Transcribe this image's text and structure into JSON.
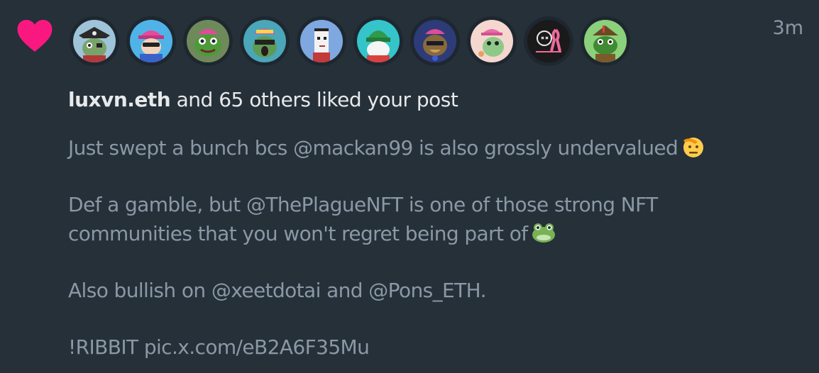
{
  "notification": {
    "timestamp": "3m",
    "summary": {
      "user": "luxvn.eth",
      "rest": " and 65 others liked your post"
    },
    "avatars": [
      {
        "name": "pirate-frog-avatar",
        "bg": "#9fc3d8"
      },
      {
        "name": "capped-character-avatar",
        "bg": "#4fb3e8"
      },
      {
        "name": "green-frog-avatar",
        "bg": "#6e8a5a"
      },
      {
        "name": "scream-frog-avatar",
        "bg": "#4aa6b8"
      },
      {
        "name": "pixel-punk-avatar",
        "bg": "#7fa8e0"
      },
      {
        "name": "green-beanie-avatar",
        "bg": "#35c4c9"
      },
      {
        "name": "dark-blue-avatar",
        "bg": "#2d3c78"
      },
      {
        "name": "pink-cap-frog-avatar",
        "bg": "#f4d7cf"
      },
      {
        "name": "skull-ribbon-avatar",
        "bg": "#1a1a1a"
      },
      {
        "name": "hunter-frog-avatar",
        "bg": "#8bd07a"
      }
    ],
    "post": {
      "line1_text": "Just swept a bunch bcs ",
      "line1_mention": "@mackan99",
      "line1_rest": " is also grossly undervalued",
      "line2_text": "Def a gamble, but ",
      "line2_mention": "@ThePlagueNFT",
      "line2_rest": " is one of those strong NFT",
      "line3_text": "communities that you won't regret being part of",
      "line4_text": "Also bullish on ",
      "line4_mention1": "@xeetdotai",
      "line4_mid": " and ",
      "line4_mention2": "@Pons_ETH",
      "line4_end": ".",
      "line5_text": "!RIBBIT ",
      "line5_link": "pic.x.com/eB2A6F35Mu"
    },
    "colors": {
      "background": "#253039",
      "heart": "#f91880",
      "text_primary": "#e7e9ea",
      "text_secondary": "#8b98a5"
    },
    "icons": {
      "heart": "heart-icon",
      "salute": "saluting-face-emoji",
      "frog": "frog-emoji"
    }
  }
}
